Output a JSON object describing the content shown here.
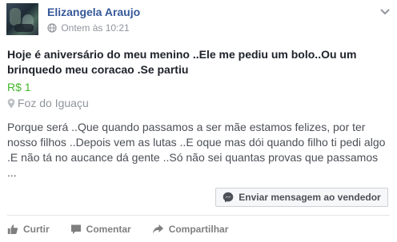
{
  "post": {
    "author": "Elizangela Araujo",
    "timestamp": "Ontem às 10:21",
    "title": "Hoje é aniversário do meu menino ..Ele me pediu um bolo..Ou um brinquedo meu coracao .Se partiu",
    "price": "R$ 1",
    "location": "Foz do Iguaçu",
    "body": "Porque será ..Que quando passamos a ser mãe estamos felizes, por ter nosso filhos ..Depois vem as lutas ..E oque mas dói quando filho ti pedi algo .E não tá no aucance dá gente ..Só não sei quantas provas que passamos ...",
    "message_button": "Enviar mensagem ao vendedor"
  },
  "actions": {
    "like": "Curtir",
    "comment": "Comentar",
    "share": "Compartilhar"
  },
  "colors": {
    "author_link": "#365899",
    "price": "#42b72a",
    "muted": "#90949c"
  },
  "icons": [
    "globe-icon",
    "chevron-down-icon",
    "location-pin-icon",
    "messenger-icon",
    "like-icon",
    "comment-icon",
    "share-icon"
  ]
}
